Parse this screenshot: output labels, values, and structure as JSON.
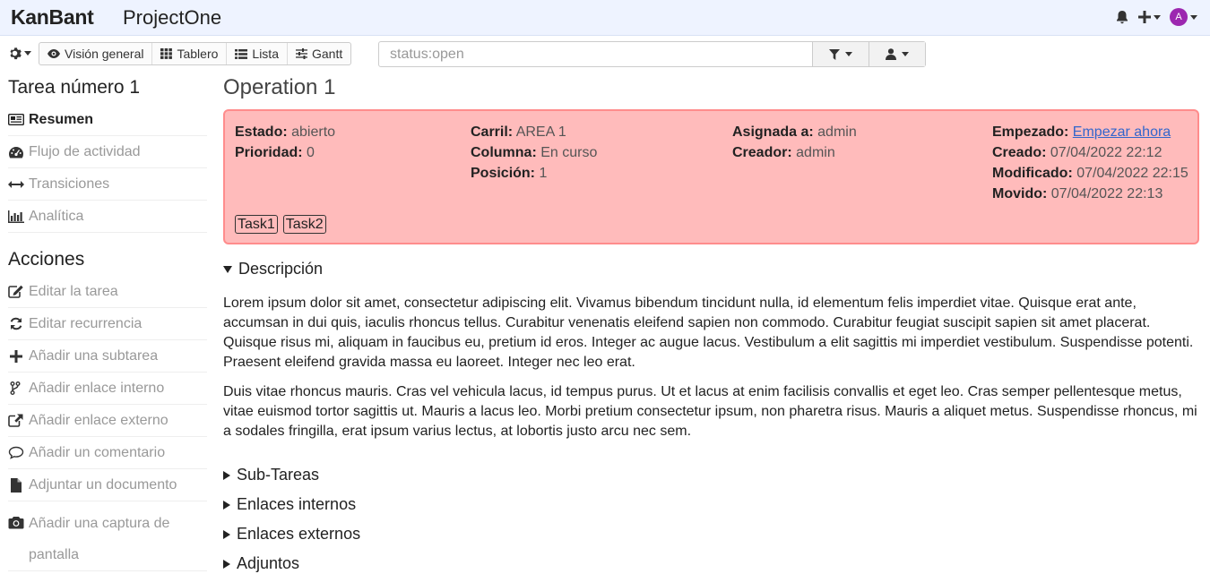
{
  "header": {
    "brand": "KanBant",
    "project": "ProjectOne",
    "avatar_letter": "A",
    "avatar_color": "#9c27b0"
  },
  "toolbar": {
    "views": [
      {
        "label": "Visión general",
        "icon": "eye-icon"
      },
      {
        "label": "Tablero",
        "icon": "board-icon"
      },
      {
        "label": "Lista",
        "icon": "list-icon"
      },
      {
        "label": "Gantt",
        "icon": "sliders-icon"
      }
    ],
    "search_placeholder": "status:open"
  },
  "sidebar": {
    "title": "Tarea número 1",
    "items": [
      {
        "label": "Resumen",
        "icon": "summary-icon"
      },
      {
        "label": "Flujo de actividad",
        "icon": "dashboard-icon"
      },
      {
        "label": "Transiciones",
        "icon": "arrows-h-icon"
      },
      {
        "label": "Analítica",
        "icon": "bar-chart-icon"
      }
    ],
    "actions_title": "Acciones",
    "actions": [
      {
        "label": "Editar la tarea",
        "icon": "edit-icon"
      },
      {
        "label": "Editar recurrencia",
        "icon": "refresh-icon"
      },
      {
        "label": "Añadir una subtarea",
        "icon": "plus-icon"
      },
      {
        "label": "Añadir enlace interno",
        "icon": "code-fork-icon"
      },
      {
        "label": "Añadir enlace externo",
        "icon": "external-link-icon"
      },
      {
        "label": "Añadir un comentario",
        "icon": "comment-icon"
      },
      {
        "label": "Adjuntar un documento",
        "icon": "file-icon"
      },
      {
        "label": "Añadir una captura de pantalla",
        "icon": "camera-icon"
      }
    ]
  },
  "task": {
    "title": "Operation 1",
    "summary_bg": "#ffbbbb",
    "summary_border": "#ff8c8c",
    "estado_label": "Estado:",
    "estado": "abierto",
    "prioridad_label": "Prioridad:",
    "prioridad": "0",
    "carril_label": "Carril:",
    "carril": "AREA 1",
    "columna_label": "Columna:",
    "columna": "En curso",
    "posicion_label": "Posición:",
    "posicion": "1",
    "asignada_label": "Asignada a:",
    "asignada": "admin",
    "creador_label": "Creador:",
    "creador": "admin",
    "empezado_label": "Empezado:",
    "empezado": "Empezar ahora",
    "creado_label": "Creado:",
    "creado": "07/04/2022 22:12",
    "modificado_label": "Modificado:",
    "modificado": "07/04/2022 22:15",
    "movido_label": "Movido:",
    "movido": "07/04/2022 22:13",
    "tags": [
      "Task1",
      "Task2"
    ]
  },
  "description": {
    "title": "Descripción",
    "paragraphs": [
      "Lorem ipsum dolor sit amet, consectetur adipiscing elit. Vivamus bibendum tincidunt nulla, id elementum felis imperdiet vitae. Quisque erat ante, accumsan in dui quis, iaculis rhoncus tellus. Curabitur venenatis eleifend sapien non commodo. Curabitur feugiat suscipit sapien sit amet placerat. Quisque risus mi, aliquam in faucibus eu, pretium id eros. Integer ac augue lacus. Vestibulum a elit sagittis mi imperdiet vestibulum. Suspendisse potenti. Praesent eleifend gravida massa eu laoreet. Integer nec leo erat.",
      "Duis vitae rhoncus mauris. Cras vel vehicula lacus, id tempus purus. Ut et lacus at enim facilisis convallis et eget leo. Cras semper pellentesque metus, vitae euismod tortor sagittis ut. Mauris a lacus leo. Morbi pretium consectetur ipsum, non pharetra risus. Mauris a aliquet metus. Suspendisse rhoncus, mi a sodales fringilla, erat ipsum varius lectus, at lobortis justo arcu nec sem."
    ]
  },
  "sections": [
    "Sub-Tareas",
    "Enlaces internos",
    "Enlaces externos",
    "Adjuntos"
  ]
}
